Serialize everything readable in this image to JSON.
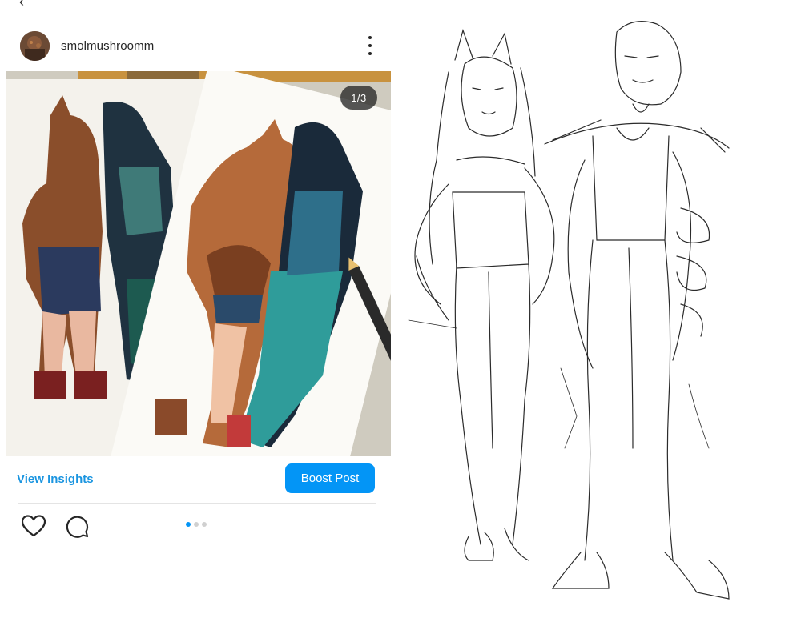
{
  "post": {
    "username": "smolmushroomm",
    "image_counter": "1/3",
    "insights_label": "View Insights",
    "boost_label": "Boost Post",
    "carousel_count": 3,
    "carousel_active": 1
  },
  "icons": {
    "back": "chevron-left-icon",
    "more": "more-vertical-icon",
    "like": "heart-icon",
    "comment": "comment-icon"
  },
  "colors": {
    "accent": "#0395f6",
    "link": "#1b95e0",
    "text": "#262626",
    "divider": "#e4e4e4"
  }
}
